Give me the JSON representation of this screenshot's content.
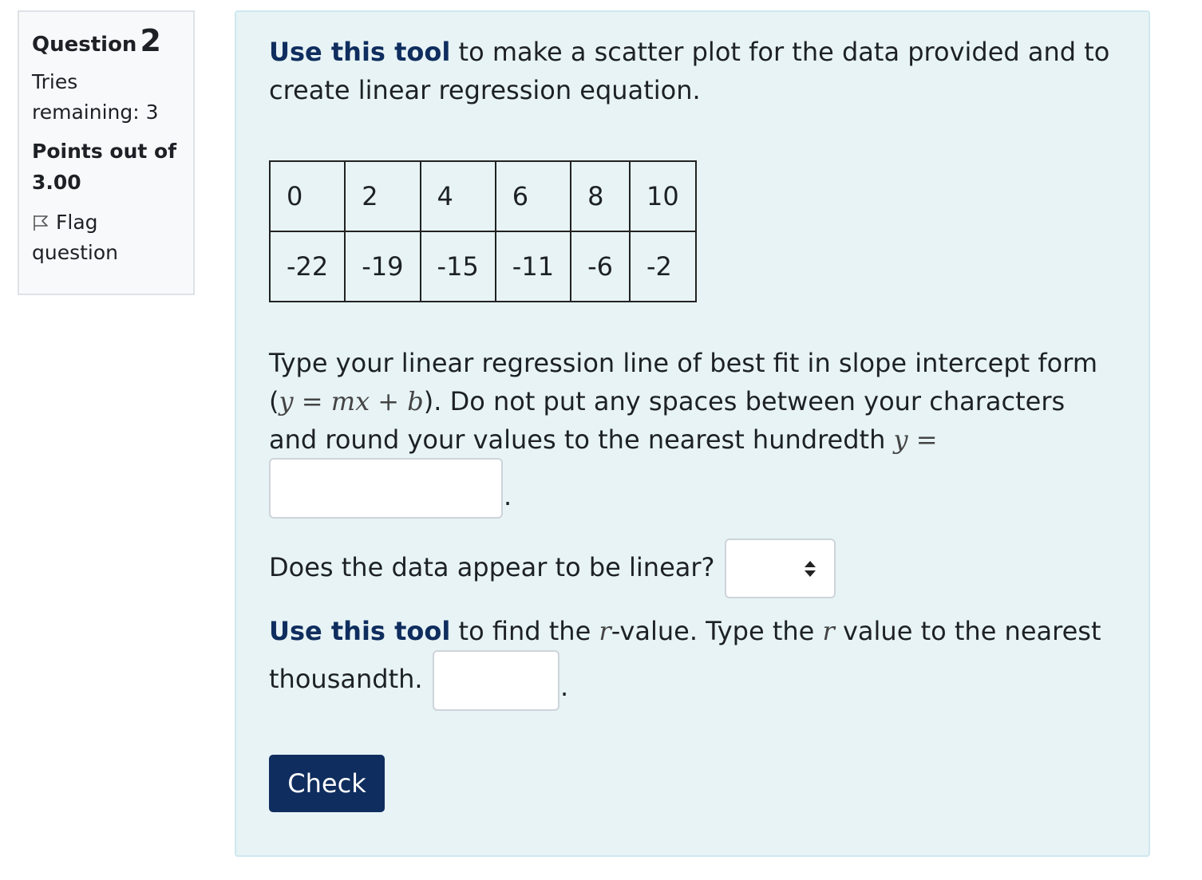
{
  "info": {
    "question_label": "Question",
    "question_number": "2",
    "tries_text": "Tries remaining: 3",
    "points_text": "Points out of 3.00",
    "flag_text": "Flag question",
    "flag_icon": "flag-icon"
  },
  "question": {
    "intro_link": "Use this tool",
    "intro_rest": " to make a scatter plot for the data provided and to create linear regression equation.",
    "table": {
      "x_row": [
        "0",
        "2",
        "4",
        "6",
        "8",
        "10"
      ],
      "y_row": [
        "-22",
        "-19",
        "-15",
        "-11",
        "-6",
        "-2"
      ]
    },
    "regression_text_1": "Type your linear regression line of best fit in slope intercept form (",
    "regression_math": {
      "y": "y",
      "eq": " = ",
      "m": "m",
      "x": "x",
      "plus": " + ",
      "b": "b"
    },
    "regression_text_2": "). Do not put any spaces between your characters and round your values to the nearest hundredth ",
    "regression_math_tail": {
      "y": "y",
      "eq": " ="
    },
    "equation_input_value": "",
    "period": ".",
    "linear_question": "Does the data appear to be linear?",
    "linear_select_value": "",
    "r_link": "Use this tool",
    "r_text_1": " to find the ",
    "r_symbol": "r",
    "r_text_2": "-value. Type the ",
    "r_text_3": " value to the nearest",
    "r_text_4": "thousandth.",
    "r_input_value": "",
    "check_label": "Check"
  },
  "colors": {
    "link": "#0f2d5e",
    "button_bg": "#0f2d5e",
    "content_bg": "#e7f3f5",
    "info_bg": "#f8f9fa"
  }
}
